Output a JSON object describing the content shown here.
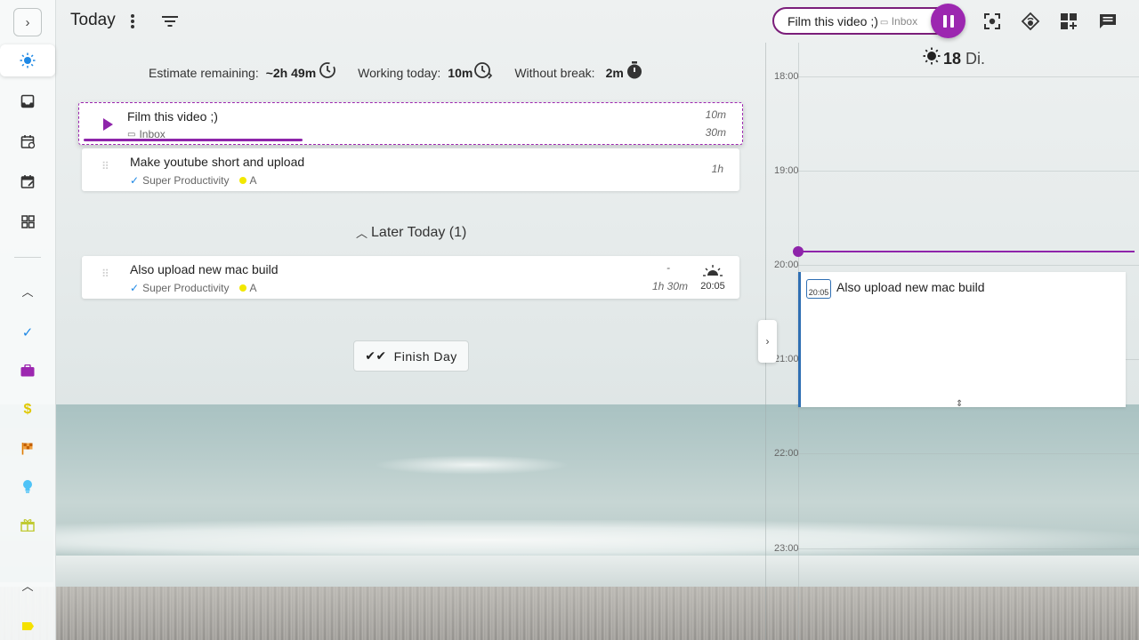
{
  "header": {
    "title": "Today",
    "current_task": {
      "title": "Film this video ;)",
      "project": "Inbox"
    }
  },
  "metrics": {
    "estimate_label": "Estimate remaining:",
    "estimate_value": "~2h 49m",
    "working_label": "Working today:",
    "working_value": "10m",
    "break_label": "Without break:",
    "break_value": "2m"
  },
  "tasks": [
    {
      "title": "Film this video ;)",
      "project": "Inbox",
      "time_spent": "10m",
      "estimate": "30m",
      "progress": 0.33,
      "current": true
    },
    {
      "title": "Make youtube short and upload",
      "project": "Super Productivity",
      "tag": "A",
      "estimate": "1h"
    }
  ],
  "later_today": {
    "label": "Later Today (1)",
    "tasks": [
      {
        "title": "Also upload new mac build",
        "project": "Super Productivity",
        "tag": "A",
        "time_spent": "-",
        "estimate": "1h 30m",
        "scheduled": "20:05"
      }
    ]
  },
  "finish_day_label": "Finish Day",
  "schedule": {
    "day_number": "18",
    "day_name": "Di.",
    "hours": [
      "18:00",
      "19:00",
      "20:00",
      "21:00",
      "22:00",
      "23:00"
    ],
    "event": {
      "title": "Also upload new mac build",
      "time": "20:05"
    }
  },
  "nav": {
    "accent_colors": {
      "check": "#1e88e5",
      "work": "#9c27b0",
      "money": "#f2d600",
      "flag": "#e07b00",
      "bulb": "#29b6f6",
      "gift": "#cddc39",
      "bottom": "#f5e100"
    },
    "icons": [
      "expand-sidebar-icon",
      "today-sun-icon",
      "inbox-icon",
      "schedule-icon",
      "planner-icon",
      "boards-icon",
      "collapse-icon",
      "check-icon",
      "briefcase-icon",
      "dollar-icon",
      "flag-icon",
      "lightbulb-icon",
      "gift-icon",
      "collapse-icon",
      "label-icon"
    ]
  },
  "colors": {
    "accent": "#9c27b0",
    "event_border": "#2f6fb3"
  }
}
